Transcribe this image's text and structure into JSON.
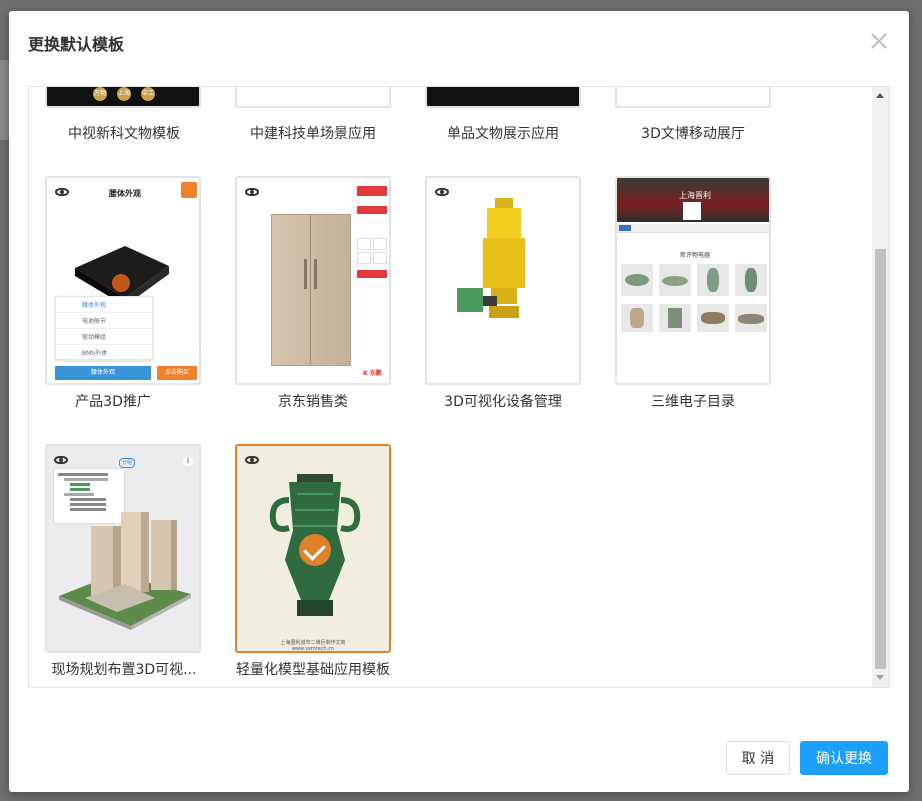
{
  "dialog": {
    "title": "更换默认模板"
  },
  "templates": {
    "row1": [
      {
        "caption": "中视新科文物模板"
      },
      {
        "caption": "中建科技单场景应用"
      },
      {
        "caption": "单品文物展示应用"
      },
      {
        "caption": "3D文博移动展厅"
      }
    ],
    "row2": [
      {
        "caption": "产品3D推广",
        "header": "腰体外观",
        "menu": [
          "腰体外观",
          "电池舱节",
          "驱动模组",
          "BMS外体"
        ],
        "button1": "腰体外观",
        "button2": "点击购买"
      },
      {
        "caption": "京东销售类",
        "brand": "K  东鹏"
      },
      {
        "caption": "3D可视化设备管理"
      },
      {
        "caption": "三维电子目录",
        "banner": "上海晋利",
        "section": "新评物电器"
      }
    ],
    "row3": [
      {
        "caption": "现场规划布置3D可视...",
        "tag": "分组"
      },
      {
        "caption": "轻量化模型基础应用模板",
        "footer1": "上海晋利城市二维巨制作文商",
        "footer2": "www.vsmtech.cn",
        "selected": true
      }
    ]
  },
  "coins": [
    "万物",
    "上海",
    "中工"
  ],
  "footer": {
    "cancel": "取 消",
    "confirm": "确认更换"
  },
  "colors": {
    "accent": "#1ea0fa",
    "selected_border": "#e0822b"
  }
}
